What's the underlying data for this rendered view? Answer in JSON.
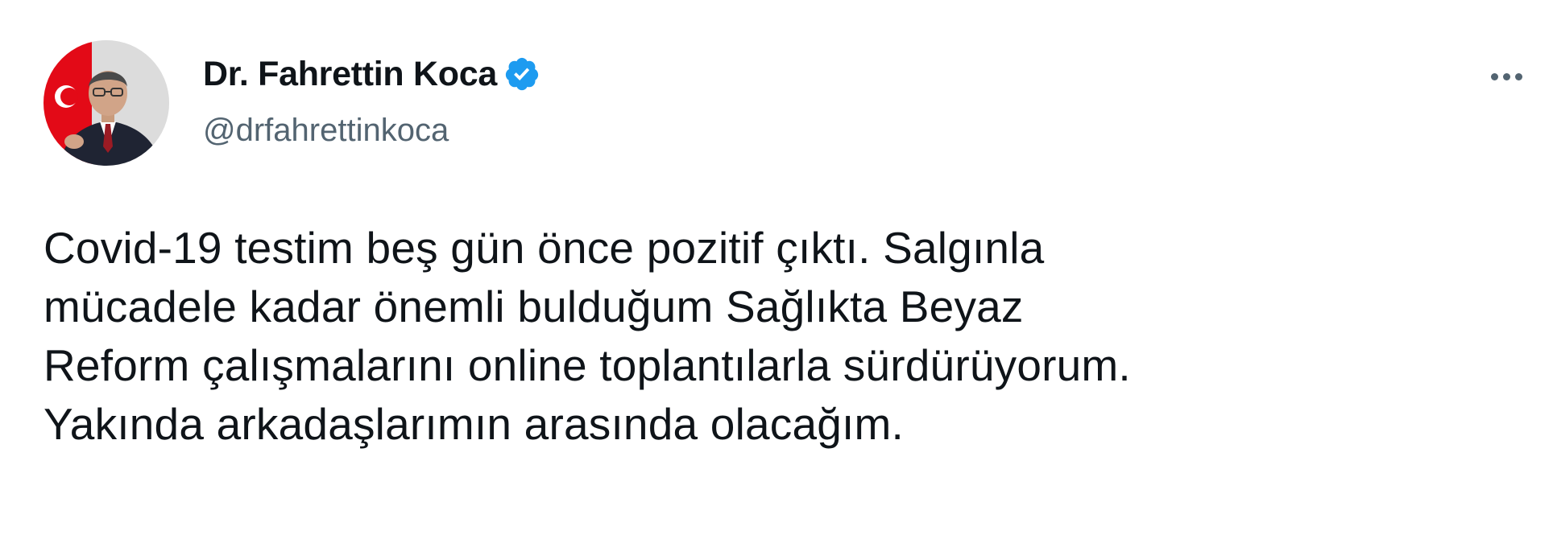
{
  "author": {
    "display_name": "Dr. Fahrettin Koca",
    "handle": "@drfahrettinkoca",
    "verified": true,
    "avatar_icon": "profile-photo",
    "verified_icon": "verified-badge-icon"
  },
  "menu": {
    "more_icon": "more-options-icon"
  },
  "tweet": {
    "lines": [
      "Covid-19 testim beş gün önce pozitif çıktı. Salgınla",
      "mücadele kadar önemli bulduğum Sağlıkta Beyaz",
      "Reform çalışmalarını online toplantılarla sürdürüyorum.",
      "Yakında arkadaşlarımın arasında olacağım."
    ]
  },
  "colors": {
    "text": "#0f1419",
    "secondary_text": "#536471",
    "verified_blue": "#1d9bf0",
    "flag_red": "#e30a17"
  }
}
